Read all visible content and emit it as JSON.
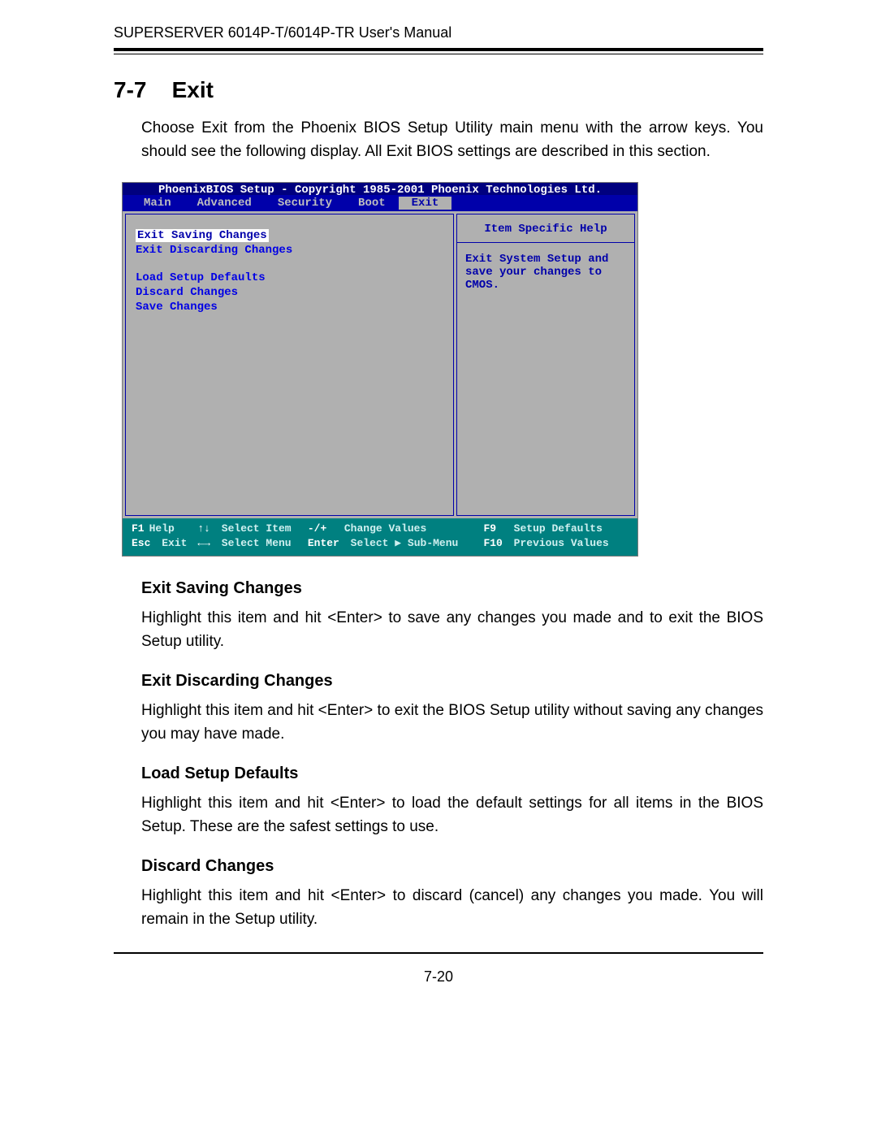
{
  "header": "SUPERSERVER 6014P-T/6014P-TR User's Manual",
  "section_number": "7-7",
  "section_title": "Exit",
  "intro": "Choose Exit from the Phoenix BIOS Setup Utility main menu with the arrow keys. You should see the following display.  All Exit BIOS settings are described in this section.",
  "bios": {
    "top_title": "PhoenixBIOS Setup - Copyright 1985-2001 Phoenix Technologies Ltd.",
    "menubar": [
      "Main",
      "Advanced",
      "Security",
      "Boot",
      "Exit"
    ],
    "menubar_selected": 4,
    "left": {
      "selected": "Exit Saving Changes",
      "items": [
        "Exit Discarding Changes",
        "",
        "Load Setup Defaults",
        "Discard Changes",
        "Save Changes"
      ]
    },
    "right": {
      "header": "Item Specific Help",
      "text": "Exit System Setup and save your changes to CMOS."
    },
    "footer": {
      "r1c1k": "F1",
      "r1c1l": "Help",
      "r1c2k": "↑↓",
      "r1c2l": "Select Item",
      "r1c3k": "-/+",
      "r1c3l": "Change Values",
      "r1c4k": "F9",
      "r1c4l": "Setup Defaults",
      "r2c1k": "Esc",
      "r2c1l": "Exit",
      "r2c2k": "←→",
      "r2c2l": "Select Menu",
      "r2c3k": "Enter",
      "r2c3l": "Select ▶ Sub-Menu",
      "r2c4k": "F10",
      "r2c4l": "Previous Values"
    }
  },
  "sections": [
    {
      "title": "Exit Saving Changes",
      "body": "Highlight this item and hit <Enter> to save any changes you made and to exit the BIOS Setup utility."
    },
    {
      "title": "Exit Discarding Changes",
      "body": "Highlight this item and hit <Enter> to exit the BIOS Setup utility without saving any changes you may have made."
    },
    {
      "title": "Load Setup Defaults",
      "body": "Highlight this item and hit <Enter> to load the default settings for all items in the BIOS Setup.  These are the safest settings to use."
    },
    {
      "title": "Discard Changes",
      "body": "Highlight this item and hit <Enter> to discard (cancel) any changes you  made. You will remain in the Setup utility."
    }
  ],
  "page_number": "7-20"
}
